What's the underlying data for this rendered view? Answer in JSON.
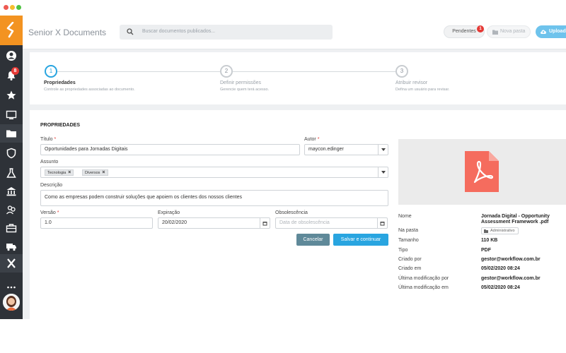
{
  "app": {
    "title": "Senior X Documents"
  },
  "sidebar": {
    "notifications_badge": "8"
  },
  "search": {
    "placeholder": "Buscar documentos publicados..."
  },
  "header": {
    "pending_label": "Pendentes",
    "pending_badge": "1",
    "new_folder_label": "Nova pasta",
    "upload_label": "Upload"
  },
  "steps": [
    {
      "number": "1",
      "title": "Propriedades",
      "subtitle": "Controle as propriedades associadas ao documento."
    },
    {
      "number": "2",
      "title": "Definir permissões",
      "subtitle": "Gerencie quem terá acesso."
    },
    {
      "number": "3",
      "title": "Atribuir revisor",
      "subtitle": "Defina um usuário para revisar."
    }
  ],
  "form": {
    "section_title": "PROPRIEDADES",
    "title_label": "Título",
    "title_value": "Oportunidades para Jornadas Digitais",
    "author_label": "Autor",
    "author_value": "maycon.edinger",
    "subject_label": "Assunto",
    "tags": [
      "Tecnologia",
      "Diversos"
    ],
    "description_label": "Descrição",
    "description_value": "Como as empresas podem construir soluções que apoiem os clientes dos nossos clientes",
    "version_label": "Versão",
    "version_value": "1.0",
    "expiration_label": "Expiração",
    "expiration_value": "20/02/2020",
    "obsolescence_label": "Obsolescência",
    "obsolescence_placeholder": "Data de obsolescência",
    "required_mark": "*",
    "tag_remove": "×",
    "cancel_label": "Cancelar",
    "save_label": "Salvar e continuar"
  },
  "details": {
    "name_label": "Nome",
    "name_value": "Jornada Digital - Opportunity Assessment Framework .pdf",
    "folder_label": "Na pasta",
    "folder_value": "Administrativo",
    "size_label": "Tamanho",
    "size_value": "110 KB",
    "type_label": "Tipo",
    "type_value": "PDF",
    "created_by_label": "Criado por",
    "created_by_value": "gestor@workflow.com.br",
    "created_at_label": "Criado em",
    "created_at_value": "05/02/2020 08:24",
    "modified_by_label": "Última modificação por",
    "modified_by_value": "gestor@workflow.com.br",
    "modified_at_label": "Última modificação em",
    "modified_at_value": "05/02/2020 08:24"
  },
  "colors": {
    "accent": "#29a5e0",
    "brand_orange": "#f39321",
    "sidebar_bg": "#2e3238",
    "pdf_red": "#f56c5e"
  }
}
